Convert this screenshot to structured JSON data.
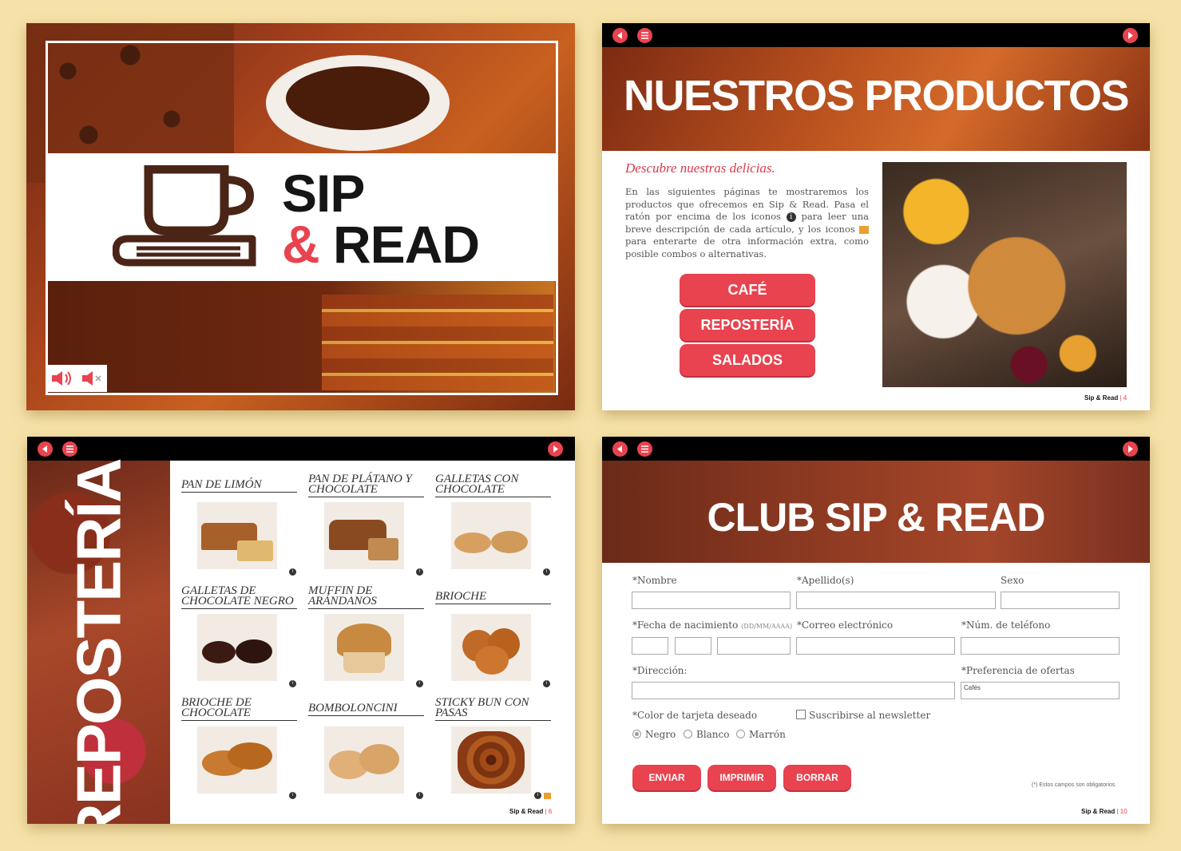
{
  "slide1": {
    "brand_line1": "SIP",
    "brand_amp": "&",
    "brand_line2": "READ",
    "audio": {
      "on_icon": "speaker-on-icon",
      "off_icon": "speaker-mute-icon"
    }
  },
  "slide2": {
    "title": "NUESTROS PRODUCTOS",
    "subtitle": "Descubre nuestras delicias.",
    "body_part1": "En las siguientes  páginas te mostraremos los productos que ofrecemos en Sip & Read. Pasa el ratón por encima de los iconos",
    "body_part2": "para leer una breve descripción de cada artículo, y los iconos",
    "body_part3": "para enterarte de otra información extra, como posible combos o alternativas.",
    "buttons": [
      "CAFÉ",
      "REPOSTERÍA",
      "SALADOS"
    ],
    "footer_brand": "Sip & Read",
    "footer_sep": " | ",
    "footer_page": "4"
  },
  "slide3": {
    "title": "REPOSTERÍA",
    "products": [
      "PAN DE LIMÓN",
      "PAN DE PLÁTANO Y CHOCOLATE",
      "GALLETAS CON CHOCOLATE",
      "GALLETAS DE CHOCOLATE NEGRO",
      "MUFFIN DE ARÁNDANOS",
      "BRIOCHE",
      "BRIOCHE DE CHOCOLATE",
      "BOMBOLONCINI",
      "STICKY BUN CON PASAS"
    ],
    "footer_brand": "Sip & Read",
    "footer_sep": " | ",
    "footer_page": "6"
  },
  "slide4": {
    "title": "CLUB SIP & READ",
    "labels": {
      "nombre": "*Nombre",
      "apellidos": "*Apellido(s)",
      "sexo": "Sexo",
      "fecha": "*Fecha de nacimiento",
      "fecha_fmt": "(DD/MM/AAAA)",
      "correo": "*Correo electrónico",
      "telefono": "*Núm. de teléfono",
      "direccion": "*Dirección:",
      "preferencia": "*Preferencia de ofertas",
      "color": "*Color de tarjeta deseado",
      "newsletter": "Suscribirse al newsletter"
    },
    "preferencia_value": "Cafés",
    "radios": [
      "Negro",
      "Blanco",
      "Marrón"
    ],
    "buttons": [
      "ENVIAR",
      "IMPRIMIR",
      "BORRAR"
    ],
    "required_note": "(*) Estos campos son obligatorios",
    "footer_brand": "Sip & Read",
    "footer_sep": " | ",
    "footer_page": "10"
  },
  "colors": {
    "accent": "#e8434f",
    "background": "#f6e2a8",
    "bar": "#000000"
  }
}
